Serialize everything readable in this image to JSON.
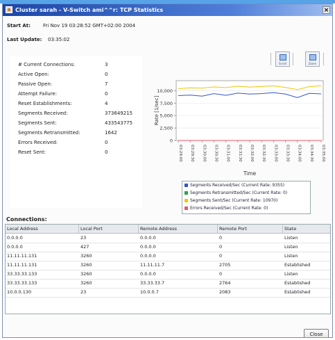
{
  "window": {
    "title": "Cluster sarah - V-Switch ami^^r: TCP Statistics",
    "close_glyph": "×"
  },
  "header": {
    "start_label": "Start At:",
    "start_value": "Fri Nov 19 03:28:52 GMT+02:00 2004",
    "update_label": "Last Update:",
    "update_value": "03:35:02"
  },
  "stats": [
    {
      "label": "# Current Connections:",
      "value": "3"
    },
    {
      "label": "Active Open:",
      "value": "0"
    },
    {
      "label": "Passive Open:",
      "value": "7"
    },
    {
      "label": "Attempt Failure:",
      "value": "0"
    },
    {
      "label": "Reset Establishments:",
      "value": "4"
    },
    {
      "label": "Segments Received:",
      "value": "373649215"
    },
    {
      "label": "Segments Sent:",
      "value": "433543775"
    },
    {
      "label": "Segments Retransmitted:",
      "value": "1642"
    },
    {
      "label": "Errors Received:",
      "value": "0"
    },
    {
      "label": "Reset Sent:",
      "value": "0"
    }
  ],
  "toolbar": {
    "scroll_label": "Scroll",
    "zoom_label": "Zoom"
  },
  "chart_data": {
    "type": "line",
    "xlabel": "Time",
    "ylabel": "Rate [1/sec]",
    "ylim": [
      0,
      12000
    ],
    "yticks": [
      "0",
      "2,500",
      "5,000",
      "7,500",
      "10,000"
    ],
    "xticks": [
      "03:29:00",
      "03:29:30",
      "03:30:00",
      "03:30:30",
      "03:31:00",
      "03:31:30",
      "03:32:00",
      "03:32:30",
      "03:33:00",
      "03:33:30",
      "03:34:00",
      "03:34:30",
      "03:35:00"
    ],
    "x": [
      "03:29:00",
      "03:29:30",
      "03:30:00",
      "03:30:30",
      "03:31:00",
      "03:31:30",
      "03:32:00",
      "03:32:30",
      "03:33:00",
      "03:33:30",
      "03:34:00",
      "03:34:30",
      "03:35:00"
    ],
    "series": [
      {
        "name": "Segments Received/Sec (Current Rate: 9355)",
        "color": "#3355cc",
        "values": [
          9000,
          9100,
          8900,
          9400,
          9050,
          9500,
          9300,
          9400,
          9600,
          9300,
          8600,
          9450,
          9355
        ]
      },
      {
        "name": "Segments Retransmitted/Sec (Current Rate: 0)",
        "color": "#22aa44",
        "values": [
          0,
          0,
          0,
          0,
          0,
          0,
          0,
          0,
          0,
          0,
          0,
          0,
          0
        ]
      },
      {
        "name": "Segments Sent/Sec (Current Rate: 10970)",
        "color": "#f5c400",
        "values": [
          10400,
          10550,
          10500,
          10750,
          10600,
          10900,
          10700,
          10850,
          10950,
          10650,
          10200,
          10800,
          10970
        ]
      },
      {
        "name": "Errors Received/Sec (Current Rate: 0)",
        "color": "#ee5566",
        "values": [
          0,
          0,
          0,
          0,
          0,
          0,
          0,
          0,
          0,
          0,
          0,
          0,
          0
        ]
      }
    ]
  },
  "connections": {
    "title": "Connections:",
    "columns": [
      "Local Address",
      "Local Port",
      "Remote Address",
      "Remote Port",
      "State"
    ],
    "rows": [
      [
        "0.0.0.0",
        "23",
        "0.0.0.0",
        "0",
        "Listen"
      ],
      [
        "0.0.0.0",
        "427",
        "0.0.0.0",
        "0",
        "Listen"
      ],
      [
        "11.11.11.131",
        "3260",
        "0.0.0.0",
        "0",
        "Listen"
      ],
      [
        "11.11.11.131",
        "3260",
        "11.11.11.7",
        "2705",
        "Established"
      ],
      [
        "33.33.33.133",
        "3260",
        "0.0.0.0",
        "0",
        "Listen"
      ],
      [
        "33.33.33.133",
        "3260",
        "33.33.33.7",
        "2764",
        "Established"
      ],
      [
        "10.0.0.130",
        "23",
        "10.0.0.7",
        "2083",
        "Established"
      ]
    ]
  },
  "footer": {
    "close_label": "Close"
  }
}
